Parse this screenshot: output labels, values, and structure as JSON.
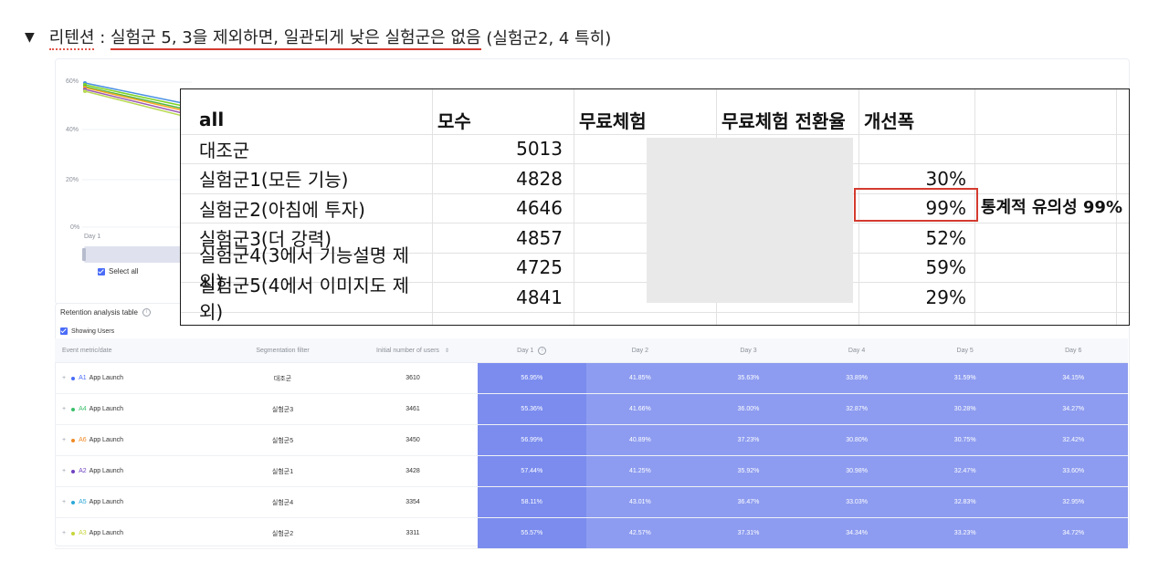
{
  "heading": {
    "toggle": "▼",
    "label": "리텐션",
    "sep": " : ",
    "main": "실험군 5, 3을 제외하면, 일관되게 낮은 실험군은 없음",
    "tail": " (실험군2, 4 특히)"
  },
  "chart": {
    "yticks": [
      "60%",
      "40%",
      "20%",
      "0%"
    ],
    "day_label": "Day 1",
    "select_all": "Select all",
    "line_colors": [
      "#4a90e2",
      "#7ed321",
      "#50b848",
      "#f5a623",
      "#9b59b6",
      "#bada55"
    ]
  },
  "retention": {
    "title": "Retention analysis table",
    "showing_users": "Showing Users",
    "headers": {
      "metric": "Event metric/date",
      "seg": "Segmentation filter",
      "init": "Initial number of users",
      "days": [
        "Day 1",
        "Day 2",
        "Day 3",
        "Day 4",
        "Day 5",
        "Day 6"
      ]
    },
    "rows": [
      {
        "id": "A1",
        "color": "#4a6cf7",
        "event": "App Launch",
        "seg": "대조군",
        "init": "3610",
        "days": [
          "56.95%",
          "41.85%",
          "35.63%",
          "33.89%",
          "31.59%",
          "34.15%"
        ]
      },
      {
        "id": "A4",
        "color": "#3bbf6a",
        "event": "App Launch",
        "seg": "실험군3",
        "init": "3461",
        "days": [
          "55.36%",
          "41.66%",
          "36.00%",
          "32.87%",
          "30.28%",
          "34.27%"
        ]
      },
      {
        "id": "A6",
        "color": "#f08a24",
        "event": "App Launch",
        "seg": "실험군5",
        "init": "3450",
        "days": [
          "56.99%",
          "40.89%",
          "37.23%",
          "30.80%",
          "30.75%",
          "32.42%"
        ]
      },
      {
        "id": "A2",
        "color": "#6f42c1",
        "event": "App Launch",
        "seg": "실험군1",
        "init": "3428",
        "days": [
          "57.44%",
          "41.25%",
          "35.92%",
          "30.98%",
          "32.47%",
          "33.60%"
        ]
      },
      {
        "id": "A5",
        "color": "#2aa7d8",
        "event": "App Launch",
        "seg": "실험군4",
        "init": "3354",
        "days": [
          "58.11%",
          "43.01%",
          "36.47%",
          "33.03%",
          "32.83%",
          "32.95%"
        ]
      },
      {
        "id": "A3",
        "color": "#c7d43a",
        "event": "App Launch",
        "seg": "실험군2",
        "init": "3311",
        "days": [
          "55.57%",
          "42.57%",
          "37.31%",
          "34.34%",
          "33.23%",
          "34.72%"
        ]
      }
    ]
  },
  "sheet": {
    "header": [
      "all",
      "모수",
      "무료체험",
      "무료체험 전환율",
      "개선폭"
    ],
    "rows": [
      {
        "name": "대조군",
        "n": "5013",
        "improve": ""
      },
      {
        "name": "실험군1(모든 기능)",
        "n": "4828",
        "improve": "30%"
      },
      {
        "name": "실험군2(아침에 투자)",
        "n": "4646",
        "improve": "99%"
      },
      {
        "name": "실험군3(더 강력)",
        "n": "4857",
        "improve": "52%"
      },
      {
        "name": "실험군4(3에서 기능설명 제외)",
        "n": "4725",
        "improve": "59%"
      },
      {
        "name": "실험군5(4에서 이미지도 제외)",
        "n": "4841",
        "improve": "29%"
      }
    ],
    "note": "통계적 유의성 99%"
  }
}
